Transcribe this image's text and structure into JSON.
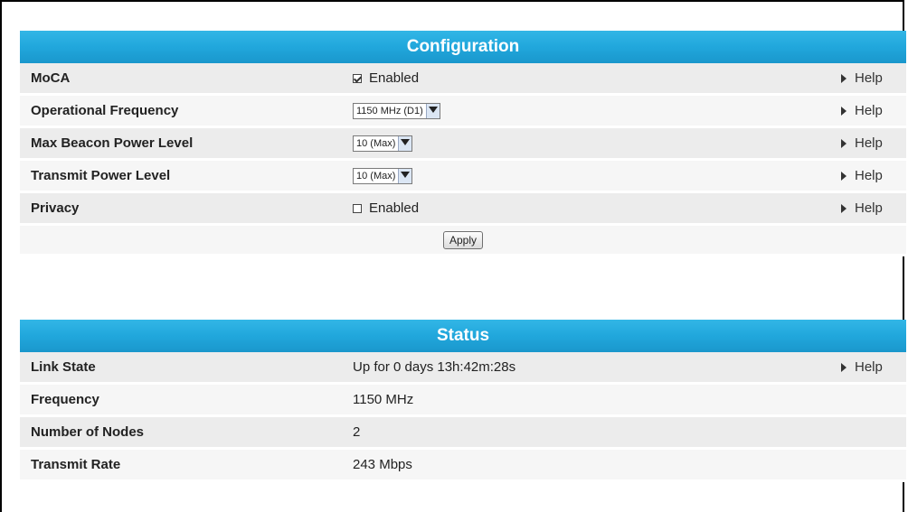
{
  "configuration": {
    "title": "Configuration",
    "help_label": "Help",
    "moca": {
      "label": "MoCA",
      "checkbox_label": "Enabled",
      "checked": true
    },
    "operational_frequency": {
      "label": "Operational Frequency",
      "selected": "1150 MHz (D1)"
    },
    "max_beacon_power_level": {
      "label": "Max Beacon Power Level",
      "selected": "10 (Max)"
    },
    "transmit_power_level": {
      "label": "Transmit Power Level",
      "selected": "10 (Max)"
    },
    "privacy": {
      "label": "Privacy",
      "checkbox_label": "Enabled",
      "checked": false
    },
    "apply_label": "Apply"
  },
  "status": {
    "title": "Status",
    "help_label": "Help",
    "link_state": {
      "label": "Link State",
      "value": "Up for 0 days 13h:42m:28s"
    },
    "frequency": {
      "label": "Frequency",
      "value": "1150 MHz"
    },
    "number_of_nodes": {
      "label": "Number of Nodes",
      "value": "2"
    },
    "transmit_rate": {
      "label": "Transmit Rate",
      "value": "243 Mbps"
    }
  },
  "icons": {
    "help": "triangle-right-icon",
    "select": "chevron-down-icon"
  }
}
